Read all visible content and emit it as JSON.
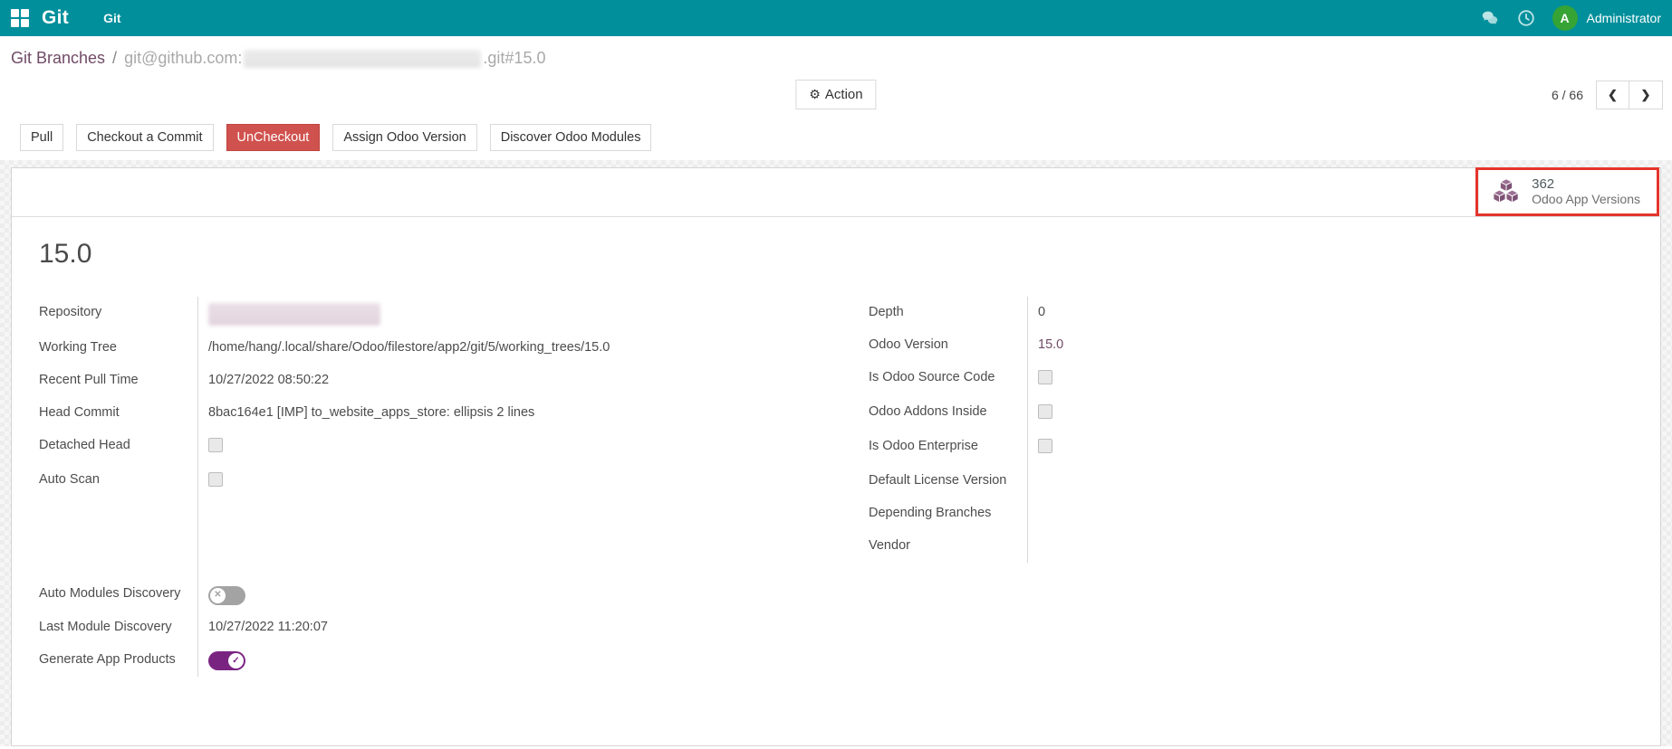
{
  "colors": {
    "navbar": "#008F9B",
    "link": "#714B67",
    "danger_button": "#D0524E",
    "toggle_on": "#7A2482",
    "annotation_box": "#E5342C",
    "avatar_green": "#35A435",
    "stat_icon_purple": "#875A7B"
  },
  "icons": {
    "gear": "⚙",
    "prev": "❮",
    "next": "❯",
    "toggle_on_glyph": "✓",
    "toggle_off_glyph": "✕"
  },
  "navbar": {
    "brand": "Git",
    "menu_item": "Git",
    "user": {
      "name": "Administrator",
      "avatar_initial": "A"
    }
  },
  "breadcrumb": {
    "parent": "Git Branches",
    "separator": "/",
    "current_prefix": "git@github.com:",
    "current_redacted": true,
    "current_suffix": ".git#15.0"
  },
  "control_panel": {
    "action_label": "Action",
    "pager_value": "6 / 66"
  },
  "workflow_buttons": {
    "pull": "Pull",
    "checkout_a_commit": "Checkout a Commit",
    "uncheckout": "UnCheckout",
    "assign_odoo_version": "Assign Odoo Version",
    "discover_odoo_modules": "Discover Odoo Modules"
  },
  "stat_button": {
    "value": "362",
    "label": "Odoo App Versions",
    "highlighted_with_red_box": true
  },
  "form": {
    "title": "15.0",
    "fields": {
      "repository": {
        "label": "Repository",
        "redacted": true
      },
      "working_tree": {
        "label": "Working Tree",
        "value": "/home/hang/.local/share/Odoo/filestore/app2/git/5/working_trees/15.0"
      },
      "recent_pull_time": {
        "label": "Recent Pull Time",
        "value": "10/27/2022 08:50:22"
      },
      "head_commit": {
        "label": "Head Commit",
        "value": "8bac164e1 [IMP] to_website_apps_store: ellipsis 2 lines"
      },
      "detached_head": {
        "label": "Detached Head",
        "checked": false
      },
      "auto_scan": {
        "label": "Auto Scan",
        "checked": false
      },
      "auto_modules_discovery": {
        "label": "Auto Modules Discovery",
        "toggle": false
      },
      "last_module_discovery": {
        "label": "Last Module Discovery",
        "value": "10/27/2022 11:20:07"
      },
      "generate_app_products": {
        "label": "Generate App Products",
        "toggle": true
      },
      "depth": {
        "label": "Depth",
        "value": "0"
      },
      "odoo_version": {
        "label": "Odoo Version",
        "value": "15.0"
      },
      "is_odoo_source_code": {
        "label": "Is Odoo Source Code",
        "checked": false
      },
      "odoo_addons_inside": {
        "label": "Odoo Addons Inside",
        "checked": false
      },
      "is_odoo_enterprise": {
        "label": "Is Odoo Enterprise",
        "checked": false
      },
      "default_license_version": {
        "label": "Default License Version",
        "value": ""
      },
      "depending_branches": {
        "label": "Depending Branches",
        "value": ""
      },
      "vendor": {
        "label": "Vendor",
        "value": ""
      }
    }
  }
}
